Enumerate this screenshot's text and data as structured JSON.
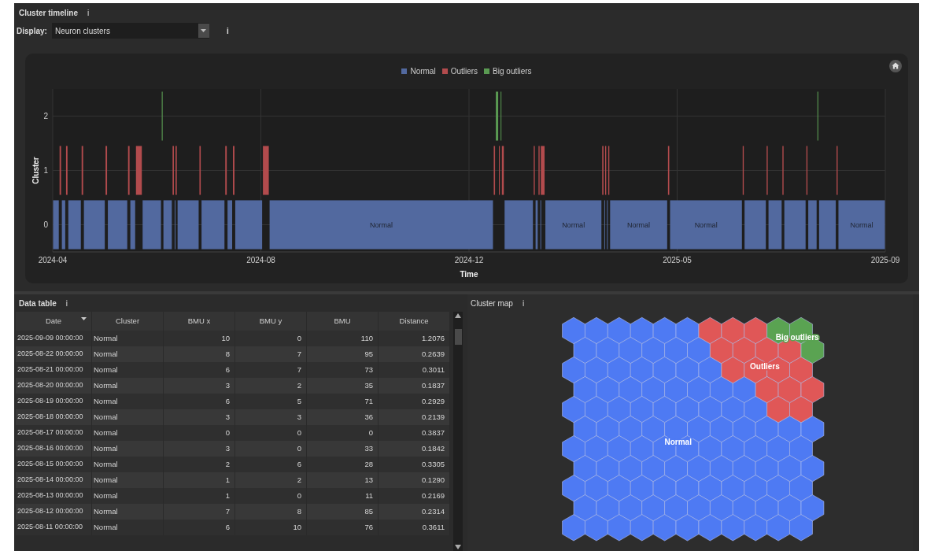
{
  "timeline": {
    "title": "Cluster timeline",
    "info": "i",
    "display": {
      "label": "Display:",
      "value": "Neuron clusters",
      "info": "i"
    },
    "legend": [
      {
        "label": "Normal",
        "color": "#52699f"
      },
      {
        "label": "Outliers",
        "color": "#b24b4d"
      },
      {
        "label": "Big outliers",
        "color": "#5a9a52"
      }
    ],
    "y_axis": {
      "title": "Cluster",
      "ticks": [
        "2",
        "1",
        "0"
      ]
    },
    "x_axis": {
      "title": "Time",
      "ticks": [
        "2024-04",
        "2024-08",
        "2024-12",
        "2025-05",
        "2025-09"
      ]
    },
    "segment_labels": [
      "Normal",
      "Normal",
      "Normal",
      "Normal",
      "Normal"
    ]
  },
  "data_table": {
    "title": "Data table",
    "info": "i",
    "columns": [
      {
        "label": "Date",
        "sorted": true
      },
      {
        "label": "Cluster",
        "sorted": false
      },
      {
        "label": "BMU x",
        "sorted": false
      },
      {
        "label": "BMU y",
        "sorted": false
      },
      {
        "label": "BMU",
        "sorted": false
      },
      {
        "label": "Distance",
        "sorted": false
      }
    ],
    "rows": [
      [
        "2025-09-09 00:00:00",
        "Normal",
        "10",
        "0",
        "110",
        "1.2076"
      ],
      [
        "2025-08-22 00:00:00",
        "Normal",
        "8",
        "7",
        "95",
        "0.2639"
      ],
      [
        "2025-08-21 00:00:00",
        "Normal",
        "6",
        "7",
        "73",
        "0.3011"
      ],
      [
        "2025-08-20 00:00:00",
        "Normal",
        "3",
        "2",
        "35",
        "0.1837"
      ],
      [
        "2025-08-19 00:00:00",
        "Normal",
        "6",
        "5",
        "71",
        "0.2929"
      ],
      [
        "2025-08-18 00:00:00",
        "Normal",
        "3",
        "3",
        "36",
        "0.2139"
      ],
      [
        "2025-08-17 00:00:00",
        "Normal",
        "0",
        "0",
        "0",
        "0.3837"
      ],
      [
        "2025-08-16 00:00:00",
        "Normal",
        "3",
        "0",
        "33",
        "0.1842"
      ],
      [
        "2025-08-15 00:00:00",
        "Normal",
        "2",
        "6",
        "28",
        "0.3305"
      ],
      [
        "2025-08-14 00:00:00",
        "Normal",
        "1",
        "2",
        "13",
        "0.1290"
      ],
      [
        "2025-08-13 00:00:00",
        "Normal",
        "1",
        "0",
        "11",
        "0.2169"
      ],
      [
        "2025-08-12 00:00:00",
        "Normal",
        "7",
        "8",
        "85",
        "0.2314"
      ],
      [
        "2025-08-11 00:00:00",
        "Normal",
        "6",
        "10",
        "76",
        "0.3611"
      ]
    ]
  },
  "cluster_map": {
    "title": "Cluster map",
    "info": "i",
    "clusters": [
      {
        "label": "Normal",
        "color": "#4e7af3"
      },
      {
        "label": "Outliers",
        "color": "#e05757"
      },
      {
        "label": "Big outliers",
        "color": "#5aa352"
      }
    ],
    "rows": [
      [
        {
          "color": "#4e7af3"
        },
        {
          "color": "#4e7af3"
        },
        {
          "color": "#4e7af3"
        },
        {
          "color": "#4e7af3"
        },
        {
          "color": "#4e7af3"
        },
        {
          "color": "#4e7af3"
        },
        {
          "color": "#e05757"
        },
        {
          "color": "#e05757"
        },
        {
          "color": "#e05757"
        },
        {
          "color": "#5aa352"
        },
        {
          "color": "#5aa352"
        }
      ],
      [
        {
          "color": "#4e7af3"
        },
        {
          "color": "#4e7af3"
        },
        {
          "color": "#4e7af3"
        },
        {
          "color": "#4e7af3"
        },
        {
          "color": "#4e7af3"
        },
        {
          "color": "#4e7af3"
        },
        {
          "color": "#e05757"
        },
        {
          "color": "#e05757"
        },
        {
          "color": "#e05757"
        },
        {
          "color": "#e05757"
        },
        {
          "color": "#5aa352"
        }
      ],
      [
        {
          "color": "#4e7af3"
        },
        {
          "color": "#4e7af3"
        },
        {
          "color": "#4e7af3"
        },
        {
          "color": "#4e7af3"
        },
        {
          "color": "#4e7af3"
        },
        {
          "color": "#4e7af3"
        },
        {
          "color": "#4e7af3"
        },
        {
          "color": "#e05757"
        },
        {
          "color": "#e05757"
        },
        {
          "color": "#e05757"
        },
        {
          "color": "#e05757"
        }
      ],
      [
        {
          "color": "#4e7af3"
        },
        {
          "color": "#4e7af3"
        },
        {
          "color": "#4e7af3"
        },
        {
          "color": "#4e7af3"
        },
        {
          "color": "#4e7af3"
        },
        {
          "color": "#4e7af3"
        },
        {
          "color": "#4e7af3"
        },
        {
          "color": "#4e7af3"
        },
        {
          "color": "#e05757"
        },
        {
          "color": "#e05757"
        },
        {
          "color": "#e05757"
        }
      ],
      [
        {
          "color": "#4e7af3"
        },
        {
          "color": "#4e7af3"
        },
        {
          "color": "#4e7af3"
        },
        {
          "color": "#4e7af3"
        },
        {
          "color": "#4e7af3"
        },
        {
          "color": "#4e7af3"
        },
        {
          "color": "#4e7af3"
        },
        {
          "color": "#4e7af3"
        },
        {
          "color": "#4e7af3"
        },
        {
          "color": "#e05757"
        },
        {
          "color": "#e05757"
        }
      ],
      [
        {
          "color": "#4e7af3"
        },
        {
          "color": "#4e7af3"
        },
        {
          "color": "#4e7af3"
        },
        {
          "color": "#4e7af3"
        },
        {
          "color": "#4e7af3"
        },
        {
          "color": "#4e7af3"
        },
        {
          "color": "#4e7af3"
        },
        {
          "color": "#4e7af3"
        },
        {
          "color": "#4e7af3"
        },
        {
          "color": "#4e7af3"
        },
        {
          "color": "#4e7af3"
        }
      ],
      [
        {
          "color": "#4e7af3"
        },
        {
          "color": "#4e7af3"
        },
        {
          "color": "#4e7af3"
        },
        {
          "color": "#4e7af3"
        },
        {
          "color": "#4e7af3"
        },
        {
          "color": "#4e7af3"
        },
        {
          "color": "#4e7af3"
        },
        {
          "color": "#4e7af3"
        },
        {
          "color": "#4e7af3"
        },
        {
          "color": "#4e7af3"
        },
        {
          "color": "#4e7af3"
        }
      ],
      [
        {
          "color": "#4e7af3"
        },
        {
          "color": "#4e7af3"
        },
        {
          "color": "#4e7af3"
        },
        {
          "color": "#4e7af3"
        },
        {
          "color": "#4e7af3"
        },
        {
          "color": "#4e7af3"
        },
        {
          "color": "#4e7af3"
        },
        {
          "color": "#4e7af3"
        },
        {
          "color": "#4e7af3"
        },
        {
          "color": "#4e7af3"
        },
        {
          "color": "#4e7af3"
        }
      ],
      [
        {
          "color": "#4e7af3"
        },
        {
          "color": "#4e7af3"
        },
        {
          "color": "#4e7af3"
        },
        {
          "color": "#4e7af3"
        },
        {
          "color": "#4e7af3"
        },
        {
          "color": "#4e7af3"
        },
        {
          "color": "#4e7af3"
        },
        {
          "color": "#4e7af3"
        },
        {
          "color": "#4e7af3"
        },
        {
          "color": "#4e7af3"
        },
        {
          "color": "#4e7af3"
        }
      ],
      [
        {
          "color": "#4e7af3"
        },
        {
          "color": "#4e7af3"
        },
        {
          "color": "#4e7af3"
        },
        {
          "color": "#4e7af3"
        },
        {
          "color": "#4e7af3"
        },
        {
          "color": "#4e7af3"
        },
        {
          "color": "#4e7af3"
        },
        {
          "color": "#4e7af3"
        },
        {
          "color": "#4e7af3"
        },
        {
          "color": "#4e7af3"
        },
        {
          "color": "#4e7af3"
        }
      ],
      [
        {
          "color": "#4e7af3"
        },
        {
          "color": "#4e7af3"
        },
        {
          "color": "#4e7af3"
        },
        {
          "color": "#4e7af3"
        },
        {
          "color": "#4e7af3"
        },
        {
          "color": "#4e7af3"
        },
        {
          "color": "#4e7af3"
        },
        {
          "color": "#4e7af3"
        },
        {
          "color": "#4e7af3"
        },
        {
          "color": "#4e7af3"
        },
        {
          "color": "#4e7af3"
        }
      ]
    ]
  }
}
